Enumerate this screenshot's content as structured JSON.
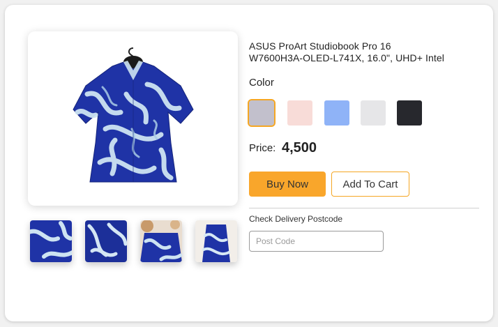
{
  "product": {
    "title_line1": "ASUS ProArt Studiobook Pro 16",
    "title_line2": "W7600H3A-OLED-L741X, 16.0\", UHD+ Intel"
  },
  "color": {
    "label": "Color",
    "swatches": [
      {
        "hex": "#c2c0cc",
        "selected": true
      },
      {
        "hex": "#f8dcd8",
        "selected": false
      },
      {
        "hex": "#8fb3f7",
        "selected": false
      },
      {
        "hex": "#e6e6e8",
        "selected": false
      },
      {
        "hex": "#27282d",
        "selected": false
      }
    ]
  },
  "price": {
    "label": "Price:",
    "value": "4,500"
  },
  "actions": {
    "buy_now": "Buy Now",
    "add_to_cart": "Add To Cart"
  },
  "delivery": {
    "label": "Check Delivery Postcode",
    "placeholder": "Post Code",
    "value": ""
  },
  "theme": {
    "accent": "#f9a62b",
    "shirt_blue": "#1f33a6",
    "shirt_pattern": "#cde3f2"
  },
  "images": {
    "main": "shirt-image",
    "thumbnails": [
      "shirt-thumbnail-1",
      "shirt-thumbnail-2",
      "shirt-thumbnail-3",
      "shirt-thumbnail-4"
    ]
  }
}
